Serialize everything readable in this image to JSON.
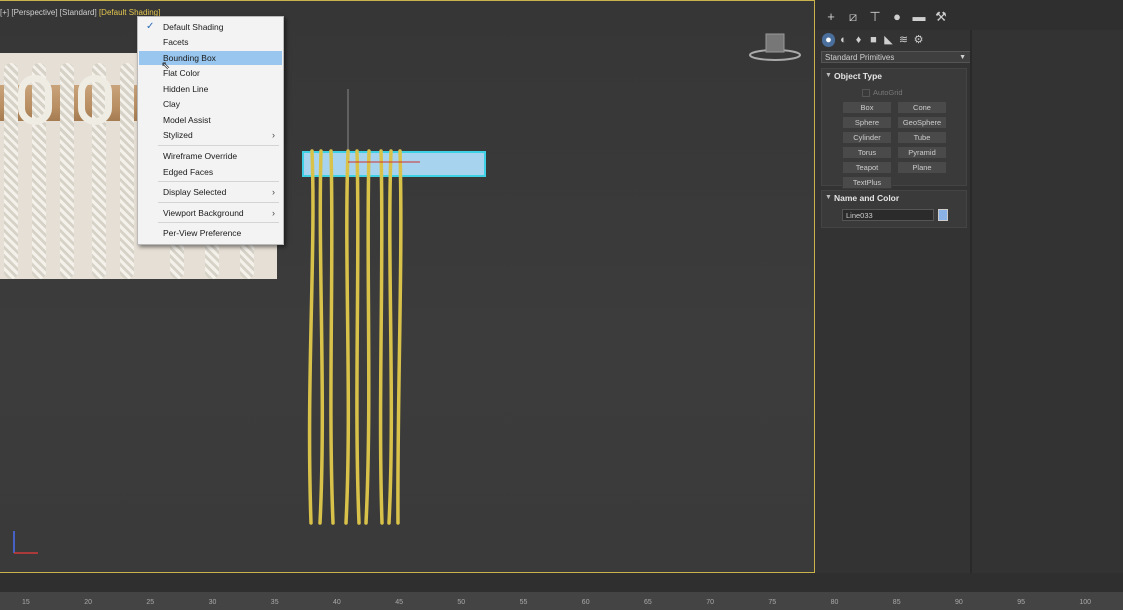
{
  "viewport": {
    "label_prefix": "[+] [Perspective] [Standard]",
    "label_shading": "[Default Shading]",
    "menu": {
      "items": [
        {
          "label": "Default Shading",
          "checked": true
        },
        {
          "label": "Facets"
        },
        {
          "label": "Bounding Box",
          "highlighted": true
        },
        {
          "label": "Flat Color"
        },
        {
          "label": "Hidden Line"
        },
        {
          "label": "Clay"
        },
        {
          "label": "Model Assist"
        },
        {
          "label": "Stylized",
          "submenu": true
        },
        {
          "label": "Wireframe Override"
        },
        {
          "label": "Edged Faces"
        },
        {
          "label": "Display Selected",
          "submenu": true
        },
        {
          "label": "Viewport Background",
          "submenu": true
        },
        {
          "label": "Per-View Preference"
        }
      ],
      "check_glyph": "✓",
      "chevron_glyph": "›"
    }
  },
  "command_panel": {
    "toolbar_icons": [
      "create-plus-icon",
      "modify-icon",
      "hierarchy-icon",
      "motion-icon",
      "display-icon",
      "utilities-wrench-icon"
    ],
    "subtool_icons": [
      "geometry-icon",
      "shapes-icon",
      "lights-icon",
      "cameras-icon",
      "helpers-icon",
      "space-warps-icon",
      "systems-icon"
    ],
    "category": "Standard Primitives",
    "object_type": {
      "title": "Object Type",
      "autogrid": "AutoGrid",
      "buttons": [
        "Box",
        "Cone",
        "Sphere",
        "GeoSphere",
        "Cylinder",
        "Tube",
        "Torus",
        "Pyramid",
        "Teapot",
        "Plane",
        "TextPlus"
      ]
    },
    "name_color": {
      "title": "Name and Color",
      "name": "Line033",
      "swatch_color": "#8ab2e6"
    }
  },
  "timeline": {
    "ticks": [
      "15",
      "20",
      "25",
      "30",
      "35",
      "40",
      "45",
      "50",
      "55",
      "60",
      "65",
      "70",
      "75",
      "80",
      "85",
      "90",
      "95",
      "100"
    ]
  },
  "colors": {
    "viewport_border": "#c9b34a",
    "highlight": "#99c6ef",
    "rope": "#d9c24a",
    "bounding_box": "#7ec8f0"
  }
}
